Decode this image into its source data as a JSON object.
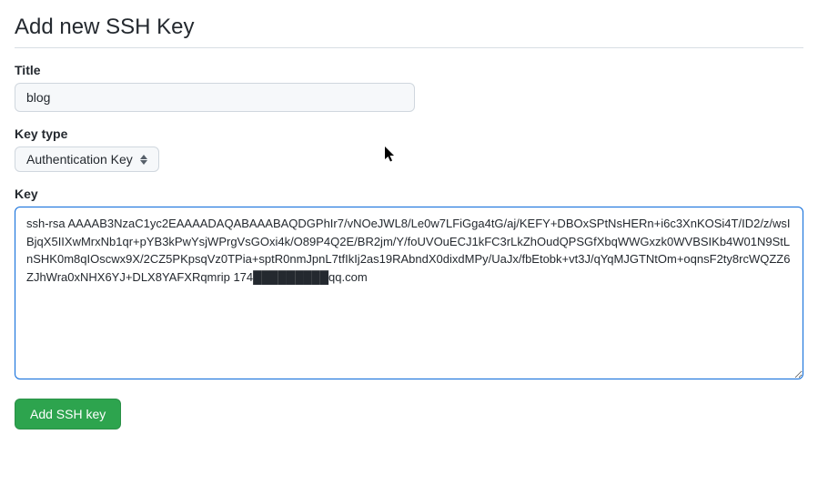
{
  "page": {
    "title": "Add new SSH Key"
  },
  "form": {
    "title_field": {
      "label": "Title",
      "value": "blog"
    },
    "key_type_field": {
      "label": "Key type",
      "selected": "Authentication Key"
    },
    "key_field": {
      "label": "Key",
      "value": "ssh-rsa AAAAB3NzaC1yc2EAAAADAQABAAABAQDGPhIr7/vNOeJWL8/Le0w7LFiGga4tG/aj/KEFY+DBOxSPtNsHERn+i6c3XnKOSi4T/ID2/z/wsIBjqX5IIXwMrxNb1qr+pYB3kPwYsjWPrgVsGOxi4k/O89P4Q2E/BR2jm/Y/foUVOuECJ1kFC3rLkZhOudQPSGfXbqWWGxzk0WVBSIKb4W01N9StLnSHK0m8qIOscwx9X/2CZ5PKpsqVz0TPia+sptR0nmJpnL7tfIkIj2as19RAbndX0dixdMPy/UaJx/fbEtobk+vt3J/qYqMJGTNtOm+oqnsF2ty8rcWQZZ6ZJhWra0xNHX6YJ+DLX8YAFXRqmrip 174█████████qq.com"
    },
    "submit_label": "Add SSH key"
  }
}
